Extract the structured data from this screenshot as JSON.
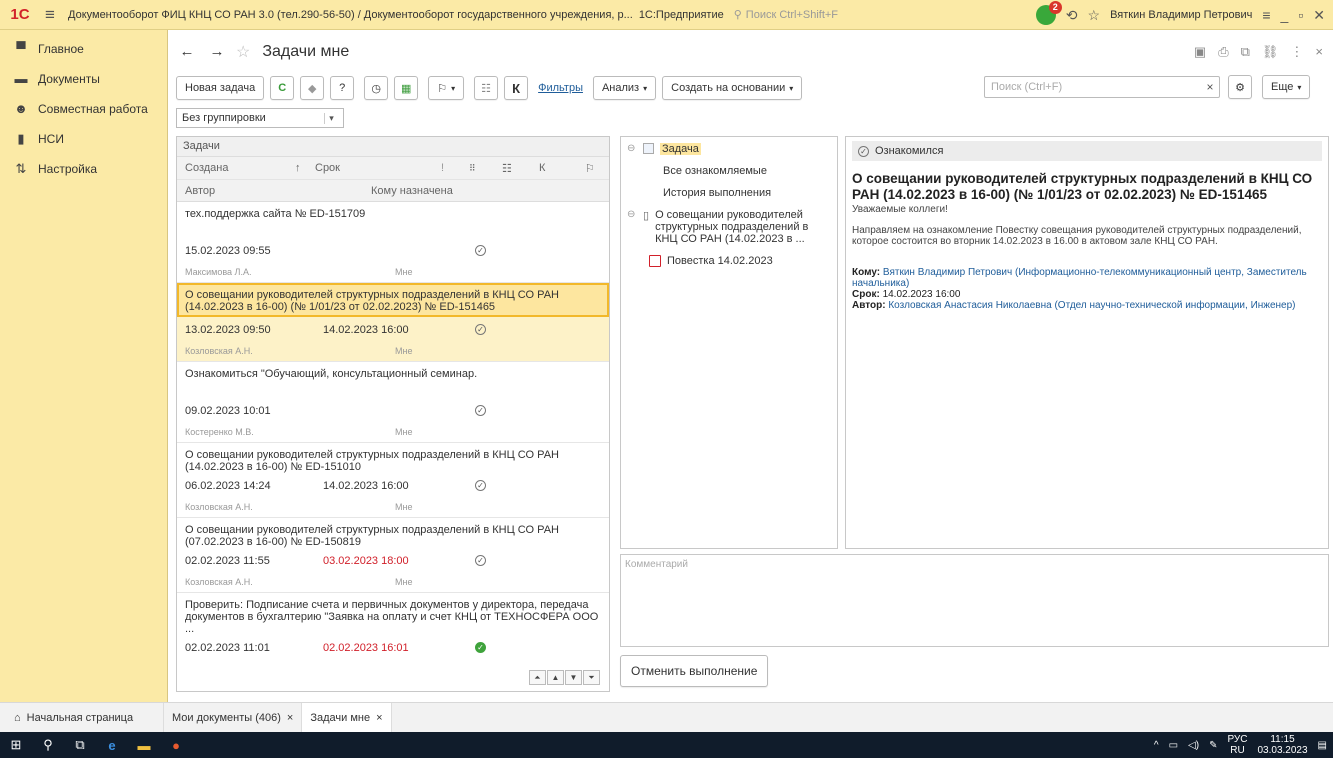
{
  "titlebar": {
    "title": "Документооборот ФИЦ КНЦ СО РАН 3.0 (тел.290-56-50) / Документооборот государственного учреждения, р...",
    "platform": "1С:Предприятие",
    "search_placeholder": "Поиск Ctrl+Shift+F",
    "notif_count": "2",
    "user": "Вяткин Владимир Петрович"
  },
  "sidebar": {
    "items": [
      {
        "label": "Главное"
      },
      {
        "label": "Документы"
      },
      {
        "label": "Совместная работа"
      },
      {
        "label": "НСИ"
      },
      {
        "label": "Настройка"
      }
    ]
  },
  "header": {
    "title": "Задачи мне"
  },
  "toolbar": {
    "new_task": "Новая задача",
    "k": "К",
    "filters": "Фильтры",
    "analysis": "Анализ",
    "create_based": "Создать на основании",
    "search_placeholder": "Поиск (Ctrl+F)",
    "more": "Еще"
  },
  "grouping": {
    "value": "Без группировки"
  },
  "tasks": {
    "caption": "Задачи",
    "columns": {
      "created": "Создана",
      "due": "Срок",
      "k": "К",
      "author": "Автор",
      "assigned": "Кому назначена"
    },
    "rows": [
      {
        "subject": "тех.поддержка сайта № ED-151709",
        "created": "15.02.2023 09:55",
        "due": "",
        "author": "Максимова Л.А.",
        "assigned": "Мне",
        "selected": false
      },
      {
        "subject": "О совещании руководителей структурных подразделений в КНЦ СО РАН (14.02.2023 в 16-00) (№ 1/01/23 от 02.02.2023) № ED-151465",
        "created": "13.02.2023 09:50",
        "due": "14.02.2023 16:00",
        "author": "Козловская А.Н.",
        "assigned": "Мне",
        "selected": true
      },
      {
        "subject": "Ознакомиться \"Обучающий, консультационный семинар.",
        "created": "09.02.2023 10:01",
        "due": "",
        "author": "Костеренко М.В.",
        "assigned": "Мне",
        "selected": false
      },
      {
        "subject": "О совещании руководителей структурных подразделений в КНЦ СО РАН (14.02.2023 в 16-00) № ED-151010",
        "created": "06.02.2023 14:24",
        "due": "14.02.2023 16:00",
        "author": "Козловская А.Н.",
        "assigned": "Мне",
        "selected": false
      },
      {
        "subject": "О совещании руководителей структурных подразделений в КНЦ СО РАН (07.02.2023 в 16-00) № ED-150819",
        "created": "02.02.2023 11:55",
        "due": "03.02.2023 18:00",
        "author": "Козловская А.Н.",
        "assigned": "Мне",
        "selected": false
      },
      {
        "subject": "Проверить: Подписание счета и первичных документов у директора, передача документов в бухгалтерию \"Заявка на оплату и счет КНЦ от ТЕХНОСФЕРА ООО ...",
        "created": "02.02.2023 11:01",
        "due": "02.02.2023 16:01",
        "author": "",
        "assigned": "",
        "selected": false
      }
    ]
  },
  "tree": {
    "task": "Задача",
    "all_ack": "Все ознакомляемые",
    "history": "История выполнения",
    "doc": "О совещании руководителей структурных подразделений в КНЦ СО РАН (14.02.2023 в ...",
    "file": "Повестка 14.02.2023"
  },
  "preview": {
    "ack_label": "Ознакомился",
    "title": "О совещании руководителей структурных подразделений в КНЦ СО РАН (14.02.2023 в 16-00) (№ 1/01/23 от 02.02.2023) № ED-151465",
    "greeting": "Уважаемые коллеги!",
    "body": "Направляем на ознакомление Повестку совещания руководителей структурных подразделений, которое состоится во вторник 14.02.2023 в 16.00 в актовом зале КНЦ СО РАН.",
    "to_label": "Кому:",
    "to_value": "Вяткин Владимир Петрович (Информационно-телекоммуникационный центр, Заместитель начальника)",
    "due_label": "Срок:",
    "due_value": "14.02.2023 16:00",
    "author_label": "Автор:",
    "author_value": "Козловская Анастасия Николаевна (Отдел научно-технической информации, Инженер)"
  },
  "comment": {
    "placeholder": "Комментарий"
  },
  "cancel_button": "Отменить выполнение",
  "bottom": {
    "home": "Начальная страница",
    "tab1": "Мои документы (406)",
    "tab2": "Задачи мне"
  },
  "taskbar": {
    "lang_top": "РУС",
    "lang_bottom": "RU",
    "time": "11:15",
    "date": "03.03.2023"
  },
  "colors": {
    "brand_yellow": "#fbeaa6",
    "selection": "#fde69f",
    "link": "#1f5d9a",
    "overdue": "#d1202a"
  }
}
